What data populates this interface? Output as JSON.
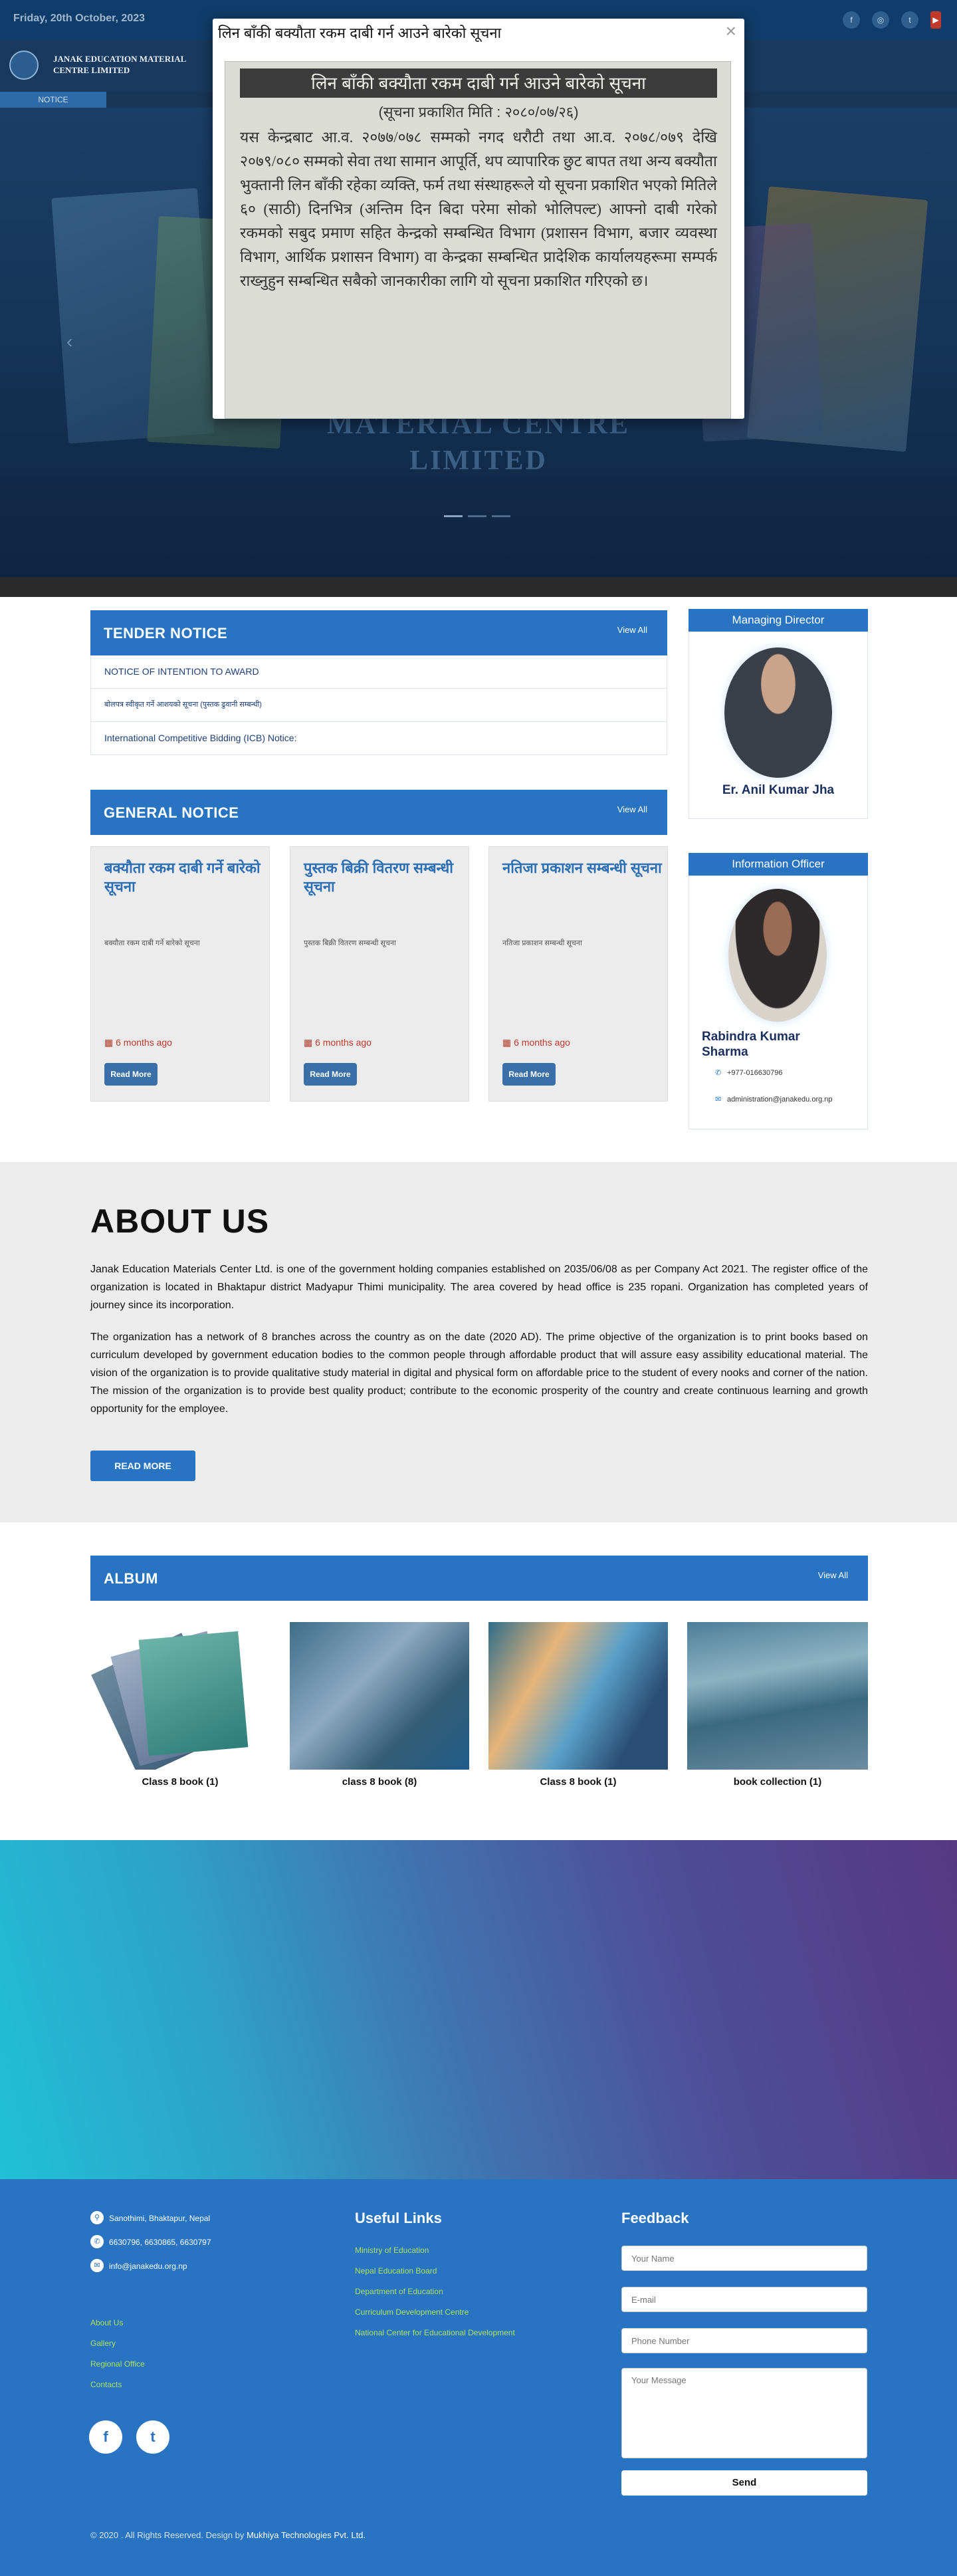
{
  "topbar": {
    "date": "Friday, 20th October, 2023",
    "social": [
      "f",
      "◎",
      "t",
      "▶"
    ]
  },
  "header": {
    "org_line1": "JANAK EDUCATION MATERIAL",
    "org_line2": "CENTRE LIMITED",
    "notice_tab": "NOTICE"
  },
  "hero": {
    "title_line1": "MATERIAL CENTRE",
    "title_line2": "LIMITED",
    "arrow_left": "‹"
  },
  "modal": {
    "title": "लिन बाँकी बक्यौता रकम दाबी गर्न आउने बारेको सूचना",
    "close": "×",
    "headline": "लिन बाँकी बक्यौता रकम दाबी गर्न आउने बारेको सूचना",
    "date_line": "(सूचना प्रकाशित मिति : २०८०/०७/२६)",
    "body": "यस केन्द्रबाट आ.व. २०७७/०७८ सम्मको नगद धरौटी तथा आ.व. २०७८/०७९ देखि २०७९/०८० सम्मको सेवा तथा सामान आपूर्ति, थप व्यापारिक छुट बापत तथा अन्य बक्यौता भुक्तानी लिन बाँकी रहेका व्यक्ति, फर्म तथा संस्थाहरूले यो सूचना प्रकाशित भएको मितिले ६० (साठी) दिनभित्र (अन्तिम दिन बिदा परेमा सोको भोलिपल्ट) आफ्नो दाबी गरेको रकमको सबुद प्रमाण सहित केन्द्रको सम्बन्धित विभाग (प्रशासन विभाग, बजार व्यवस्था विभाग, आर्थिक प्रशासन विभाग) वा केन्द्रका सम्बन्धित प्रादेशिक कार्यालयहरूमा सम्पर्क राख्नुहुन सम्बन्धित सबैको जानकारीका लागि यो सूचना प्रकाशित गरिएको छ।"
  },
  "tender": {
    "title": "TENDER NOTICE",
    "view_all": "View All",
    "rows": [
      "NOTICE OF INTENTION TO AWARD",
      "बोलपत्र स्वीकृत गर्ने आशयको सूचना (पुस्तक ढुवानी सम्बन्धी)",
      "International Competitive Bidding (ICB) Notice:"
    ]
  },
  "general": {
    "title": "GENERAL NOTICE",
    "view_all": "View All",
    "cards": [
      {
        "title": "बक्यौता रकम दाबी गर्ने बारेको सूचना",
        "desc": "बक्यौता रकम दाबी गर्ने बारेको सूचना",
        "ago": "6 months ago",
        "btn": "Read More"
      },
      {
        "title": "पुस्तक बिक्री वितरण सम्बन्धी सूचना",
        "desc": "पुस्तक बिक्री वितरण सम्बन्धी सूचना",
        "ago": "6 months ago",
        "btn": "Read More"
      },
      {
        "title": "नतिजा प्रकाशन सम्बन्धी सूचना",
        "desc": "नतिजा प्रकाशन सम्बन्धी सूचना",
        "ago": "6 months ago",
        "btn": "Read More"
      }
    ]
  },
  "md": {
    "head": "Managing Director",
    "name": "Er. Anil Kumar Jha"
  },
  "io": {
    "head": "Information Officer",
    "name": "Rabindra Kumar Sharma",
    "phone": "+977-016630796",
    "email": "administration@janakedu.org.np"
  },
  "about": {
    "title": "ABOUT US",
    "p1": "Janak Education Materials Center Ltd. is one of the government holding companies established on 2035/06/08 as per Company Act 2021. The register office of the organization is located in Bhaktapur district Madyapur Thimi municipality. The area covered by head office is 235 ropani. Organization has completed years of journey since its incorporation.",
    "p2": "The organization has a network of 8 branches across the country as on the date (2020 AD). The prime objective of the organization is to print books based on curriculum developed by government education bodies to the common people through affordable product that will assure easy assibility educational material. The vision of the organization is to provide qualitative study material in digital and physical form on affordable price to the student of every nooks and corner of the nation. The mission of the organization is to provide best quality product; contribute to the economic prosperity of the country and create continuous learning and growth opportunity for the employee.",
    "btn": "READ MORE"
  },
  "album": {
    "title": "ALBUM",
    "view_all": "View All",
    "items": [
      "Class 8 book (1)",
      "class 8 book (8)",
      "Class 8 book (1)",
      "book collection (1)"
    ]
  },
  "footer": {
    "address": "Sanothimi, Bhaktapur, Nepal",
    "phones": "6630796, 6630865, 6630797",
    "email": "info@janakedu.org.np",
    "links_left": [
      "About Us",
      "Gallery",
      "Regional Office",
      "Contacts"
    ],
    "useful_title": "Useful Links",
    "useful_links": [
      "Ministry of Education",
      "Nepal Education Board",
      "Department of Education",
      "Curriculum Development Centre",
      "National Center for Educational Development"
    ],
    "feedback_title": "Feedback",
    "ph_name": "Your Name",
    "ph_email": "E-mail",
    "ph_phone": "Phone Number",
    "ph_message": "Your Message",
    "send": "Send",
    "copyright": "© 2020 . All Rights Reserved. Design by",
    "designer": "Mukhiya Technologies Pvt. Ltd.",
    "social": [
      "f",
      "t"
    ]
  }
}
